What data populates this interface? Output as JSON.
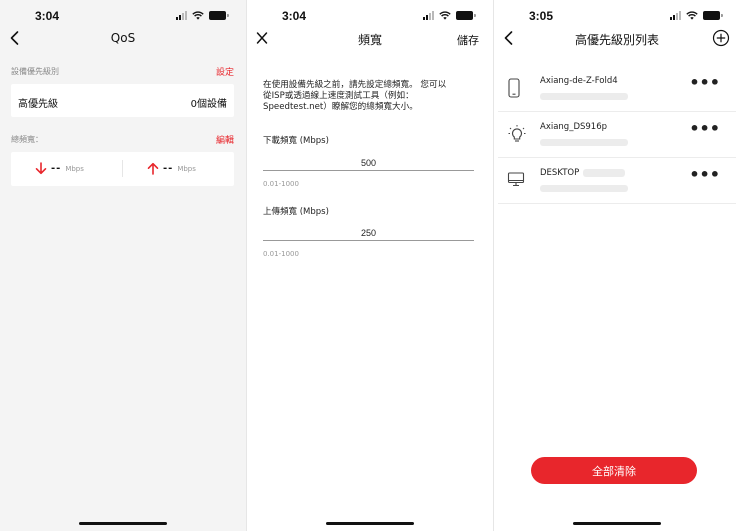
{
  "status_times": [
    "3:04",
    "3:04",
    "3:05"
  ],
  "screen1": {
    "title": "QoS",
    "section1_label": "設備優先級別",
    "section1_action": "設定",
    "priority_row": {
      "label": "高優先級",
      "value": "0個設備"
    },
    "section2_label": "總頻寬：",
    "section2_action": "編輯",
    "bandwidth": {
      "down_value": "--",
      "down_unit": "Mbps",
      "up_value": "--",
      "up_unit": "Mbps"
    },
    "colors": {
      "accent": "#e8262c"
    }
  },
  "screen2": {
    "title": "頻寬",
    "save_label": "儲存",
    "intro_line1": "在使用設備先級之前，請先設定總頻寬。 您可以",
    "intro_line2": "從ISP或透過線上速度測試工具（例如：",
    "intro_line3": "Speedtest.net）瞭解您的總頻寬大小。",
    "download": {
      "label": "下載頻寬 (Mbps)",
      "value": "500",
      "hint": "0.01-1000"
    },
    "upload": {
      "label": "上傳頻寬 (Mbps)",
      "value": "250",
      "hint": "0.01-1000"
    }
  },
  "screen3": {
    "title": "高優先級別列表",
    "devices": [
      {
        "name": "Axiang-de-Z-Fold4",
        "icon": "phone-icon"
      },
      {
        "name": "Axiang_DS916p",
        "icon": "bulb-icon"
      },
      {
        "name": "DESKTOP",
        "icon": "monitor-icon"
      }
    ],
    "more_label": "•••",
    "clear_button": "全部清除"
  }
}
